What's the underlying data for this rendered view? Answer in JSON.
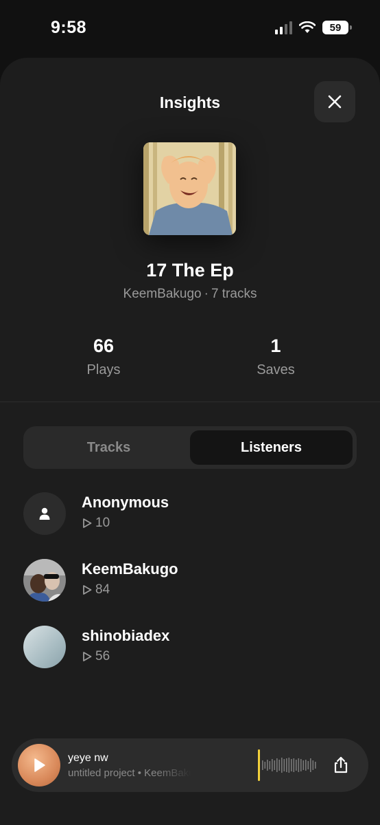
{
  "status_bar": {
    "time": "9:58",
    "battery": "59"
  },
  "header": {
    "title": "Insights"
  },
  "album": {
    "title": "17 The Ep",
    "artist": "KeemBakugo",
    "separator": "·",
    "tracks": "7 tracks"
  },
  "stats": {
    "plays": {
      "value": "66",
      "label": "Plays"
    },
    "saves": {
      "value": "1",
      "label": "Saves"
    }
  },
  "tabs": [
    {
      "label": "Tracks",
      "active": false
    },
    {
      "label": "Listeners",
      "active": true
    }
  ],
  "listeners": [
    {
      "name": "Anonymous",
      "plays": "10",
      "avatar": "person-icon"
    },
    {
      "name": "KeemBakugo",
      "plays": "84",
      "avatar": "photo"
    },
    {
      "name": "shinobiadex",
      "plays": "56",
      "avatar": "gradient"
    }
  ],
  "now_playing": {
    "title": "yeye nw",
    "subtitle": "untitled project • KeemBakugo"
  },
  "colors": {
    "background": "#111111",
    "sheet": "#1d1d1d",
    "accent_play": "#d9895a",
    "waveform_cursor": "#f2d13b"
  }
}
